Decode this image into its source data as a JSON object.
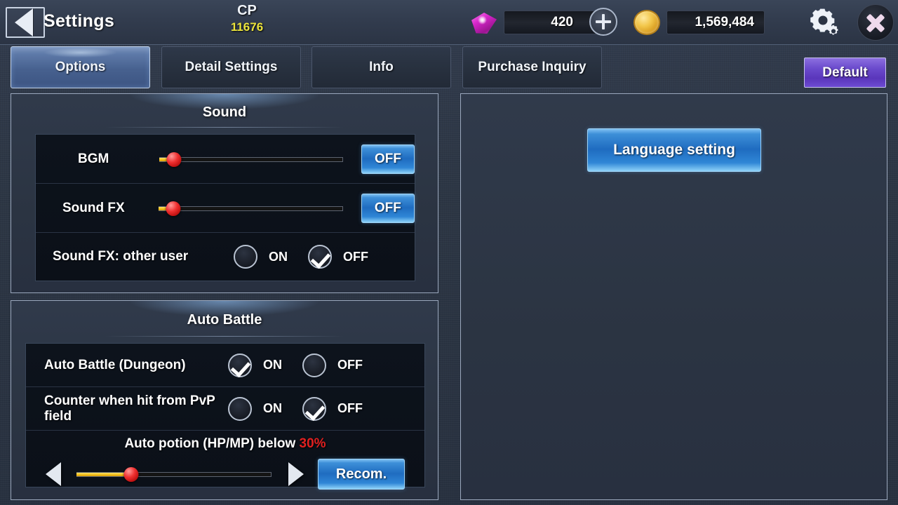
{
  "header": {
    "back_icon": "back-arrow-icon",
    "title": "Settings",
    "cp_label": "CP",
    "cp_value": "11676",
    "gem_icon": "gem-icon",
    "gem_value": "420",
    "plus_icon": "plus-icon",
    "coin_icon": "gold-coin-icon",
    "gold_value": "1,569,484",
    "gear_icon": "gear-icon",
    "close_icon": "close-icon"
  },
  "tabs": [
    {
      "label": "Options",
      "active": true
    },
    {
      "label": "Detail Settings",
      "active": false
    },
    {
      "label": "Info",
      "active": false
    },
    {
      "label": "Purchase Inquiry",
      "active": false
    }
  ],
  "default_button": {
    "label": "Default"
  },
  "sound_panel": {
    "title": "Sound",
    "rows": [
      {
        "label": "BGM",
        "slider_percent": 8,
        "button": "OFF"
      },
      {
        "label": "Sound FX",
        "slider_percent": 8,
        "button": "OFF"
      },
      {
        "label": "Sound FX: other user",
        "on_label": "ON",
        "off_label": "OFF",
        "selected": "OFF"
      }
    ]
  },
  "auto_battle_panel": {
    "title": "Auto Battle",
    "rows": [
      {
        "label": "Auto Battle (Dungeon)",
        "on_label": "ON",
        "off_label": "OFF",
        "selected": "ON"
      },
      {
        "label": "Counter when hit from PvP field",
        "on_label": "ON",
        "off_label": "OFF",
        "selected": "OFF"
      }
    ],
    "potion": {
      "text_before": "Auto potion (HP/MP) below ",
      "value": "30%",
      "value_color": "#e02020",
      "slider_percent": 28,
      "left_arrow_icon": "chevron-left-icon",
      "right_arrow_icon": "chevron-right-icon",
      "recommend_button": "Recom."
    }
  },
  "right_panel": {
    "language_button": "Language setting"
  }
}
